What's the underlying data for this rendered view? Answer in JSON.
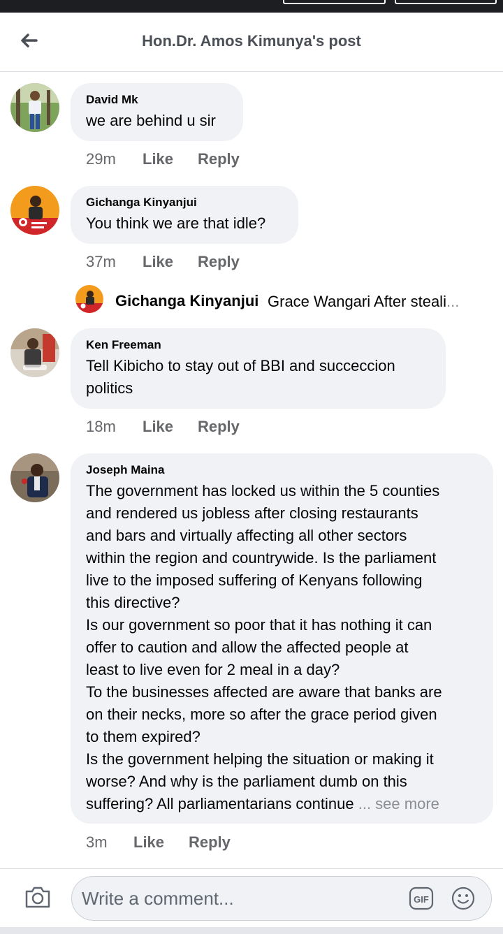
{
  "header": {
    "title": "Hon.Dr. Amos Kimunya's post"
  },
  "comments": [
    {
      "author": "David Mk",
      "text": "we are behind u sir",
      "time": "29m",
      "like": "Like",
      "reply": "Reply"
    },
    {
      "author": "Gichanga Kinyanjui",
      "text": "You think we are that idle?",
      "time": "37m",
      "like": "Like",
      "reply": "Reply"
    },
    {
      "author": "Ken Freeman",
      "text": "Tell Kibicho to stay out of BBI and succeccion politics",
      "time": "18m",
      "like": "Like",
      "reply": "Reply"
    },
    {
      "author": "Joseph Maina",
      "lines": [
        "The government has locked us within the 5 counties",
        "and rendered us jobless after closing restaurants",
        "and bars and virtually affecting all other sectors",
        "within the region and countrywide. Is the parliament",
        "live to the imposed suffering of Kenyans following",
        "this directive?",
        "Is our government so poor that it has nothing it can",
        "offer to caution and allow the affected people at",
        "least to live even for 2 meal in a day?",
        "To the businesses affected are aware that banks are",
        "on their necks, more so after the grace period given",
        "to them expired?",
        "Is the government helping the situation or making it",
        "worse? And why is the parliament dumb on this",
        "suffering? All parliamentarians continue"
      ],
      "see_more": "... see more",
      "time": "3m",
      "like": "Like",
      "reply": "Reply"
    }
  ],
  "reply_preview": {
    "author": "Gichanga Kinyanjui",
    "snippet": "Grace Wangari After steali",
    "ellipsis": "..."
  },
  "composer": {
    "placeholder": "Write a comment...",
    "gif_label": "GIF"
  },
  "colors": {
    "bubble": "#f0f2f5",
    "meta": "#65676b",
    "text": "#050505",
    "header_text": "#4b4f56"
  },
  "icons": [
    "back-arrow-icon",
    "camera-icon",
    "gif-icon",
    "smiley-icon"
  ]
}
